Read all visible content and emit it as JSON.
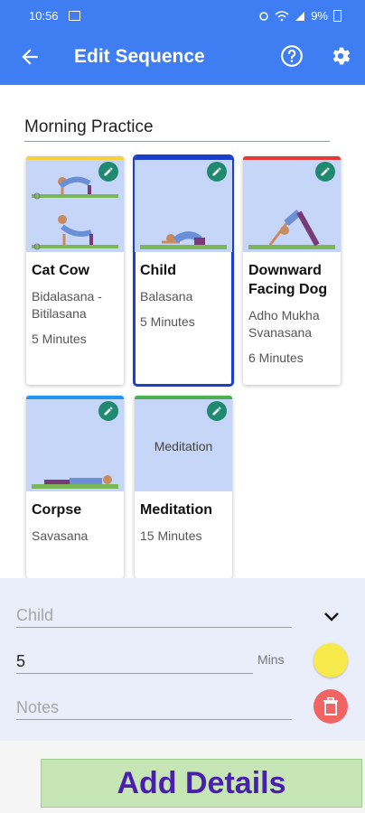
{
  "status_bar": {
    "time": "10:56",
    "battery": "9%"
  },
  "app_bar": {
    "title": "Edit Sequence"
  },
  "sequence": {
    "name": "Morning Practice"
  },
  "cards": [
    {
      "name": "Cat Cow",
      "sanskrit": "Bidalasana - Bitilasana",
      "duration": "5 Minutes",
      "accent": "#f5d03b",
      "selected": false
    },
    {
      "name": "Child",
      "sanskrit": "Balasana",
      "duration": "5 Minutes",
      "accent": "#1b3fc9",
      "selected": true
    },
    {
      "name": "Downward Facing Dog",
      "sanskrit": "Adho Mukha Svanasana",
      "duration": "6 Minutes",
      "accent": "#e53935",
      "selected": false
    },
    {
      "name": "Corpse",
      "sanskrit": "Savasana",
      "duration": "",
      "accent": "#2196f3",
      "selected": false
    },
    {
      "name": "Meditation",
      "image_text": "Meditation",
      "duration": "15 Minutes",
      "accent": "#4caf50",
      "selected": false
    }
  ],
  "editor": {
    "pose_value": "Child",
    "minutes_value": "5",
    "minutes_unit": "Mins",
    "notes_placeholder": "Notes",
    "color": "#f7ea4a"
  },
  "actions": {
    "add_details": "Add Details"
  },
  "icons": [
    "back-arrow-icon",
    "help-icon",
    "gear-icon",
    "pencil-icon",
    "chevron-down-icon",
    "trash-icon"
  ]
}
